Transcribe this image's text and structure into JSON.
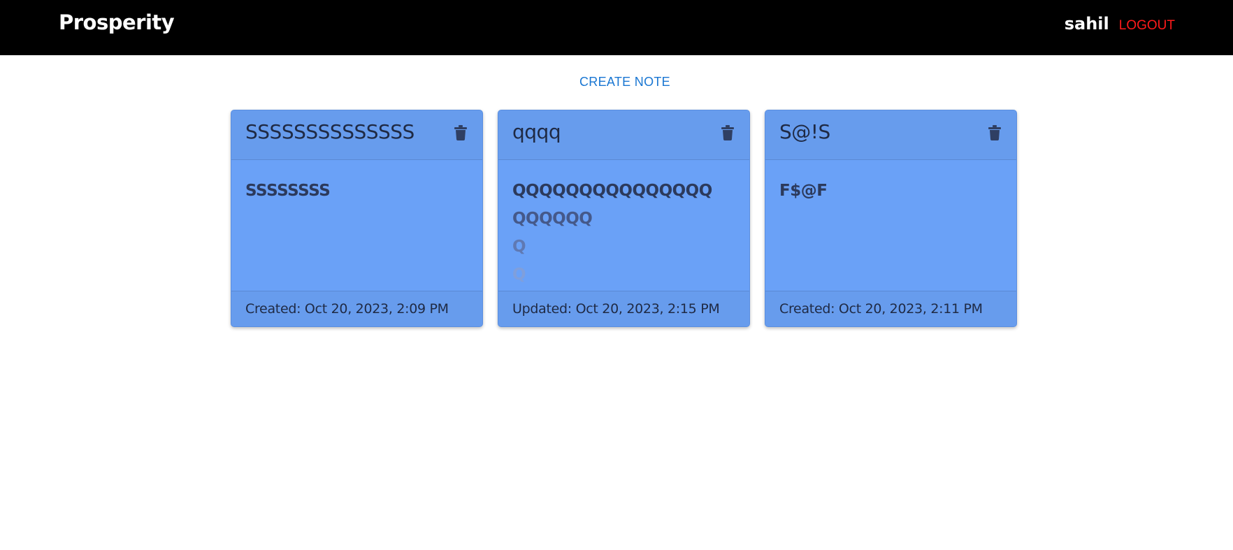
{
  "navbar": {
    "brand": "Prosperity",
    "username": "sahil",
    "logout_label": "LOGOUT"
  },
  "actions": {
    "create_note_label": "CREATE NOTE"
  },
  "notes": [
    {
      "title": "SSSSSSSSSSSSSS",
      "body_lines": [
        "SSSSSSSS"
      ],
      "footer": "Created: Oct 20, 2023, 2:09 PM",
      "icon": "trash-icon"
    },
    {
      "title": "qqqq",
      "body_lines": [
        "QQQQQQQQQQQQQQQ",
        "QQQQQQ",
        "Q",
        "Q"
      ],
      "footer": "Updated: Oct 20, 2023, 2:15 PM",
      "icon": "trash-icon"
    },
    {
      "title": "S@!S",
      "body_lines": [
        "F$@F"
      ],
      "footer": "Created: Oct 20, 2023, 2:11 PM",
      "icon": "trash-icon"
    }
  ],
  "colors": {
    "navbar_bg": "#000000",
    "logout": "#ff1a1a",
    "create_note": "#1976d2",
    "card_bg": "#6aa1f7"
  }
}
